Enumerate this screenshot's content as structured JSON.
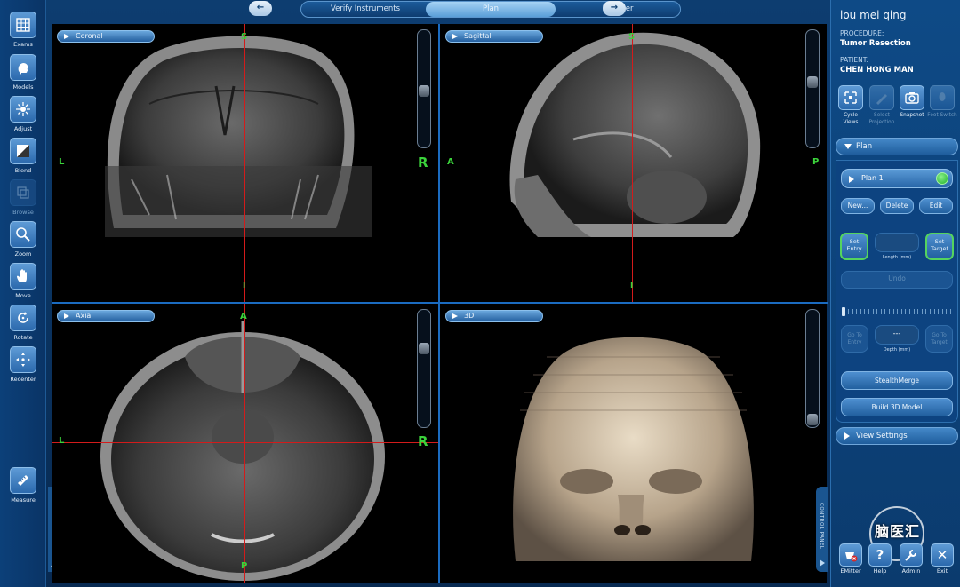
{
  "left_toolbar": {
    "tools": [
      {
        "label": "Exams",
        "icon": "grid-icon",
        "enabled": true
      },
      {
        "label": "Models",
        "icon": "head-model-icon",
        "enabled": true
      },
      {
        "label": "Adjust",
        "icon": "brightness-icon",
        "enabled": true
      },
      {
        "label": "Blend",
        "icon": "blend-icon",
        "enabled": true
      },
      {
        "label": "Browse",
        "icon": "browse-icon",
        "enabled": false
      },
      {
        "label": "Zoom",
        "icon": "zoom-icon",
        "enabled": true
      },
      {
        "label": "Move",
        "icon": "hand-icon",
        "enabled": true
      },
      {
        "label": "Rotate",
        "icon": "rotate-icon",
        "enabled": true
      },
      {
        "label": "Recenter",
        "icon": "recenter-icon",
        "enabled": true
      }
    ],
    "measure_label": "Measure",
    "modify_tab_label": "MODIFY IMAGES"
  },
  "workflow_tabs": {
    "items": [
      "Verify Instruments",
      "Plan",
      "Register"
    ],
    "active": "Plan"
  },
  "views": {
    "coronal": {
      "label": "Coronal",
      "top": "S",
      "bottom": "I",
      "left": "L",
      "right": "R"
    },
    "sagittal": {
      "label": "Sagittal",
      "top": "S",
      "bottom": "I",
      "left": "A",
      "right": "P"
    },
    "axial": {
      "label": "Axial",
      "top": "A",
      "bottom": "P",
      "left": "L",
      "right": "R"
    },
    "three_d": {
      "label": "3D"
    }
  },
  "right_panel": {
    "user": "lou mei qing",
    "procedure_key": "PROCEDURE:",
    "procedure_value": "Tumor Resection",
    "patient_key": "PATIENT:",
    "patient_value": "CHEN HONG MAN",
    "tools": [
      {
        "label": "Cycle Views",
        "icon": "cycle-views-icon",
        "enabled": true
      },
      {
        "label": "Select Projection",
        "icon": "projection-icon",
        "enabled": false
      },
      {
        "label": "Snapshot",
        "icon": "camera-icon",
        "enabled": true
      },
      {
        "label": "Foot Switch",
        "icon": "foot-switch-icon",
        "enabled": false
      }
    ],
    "plan_section": "Plan",
    "plan_name": "Plan 1",
    "new_label": "New...",
    "delete_label": "Delete",
    "edit_label": "Edit",
    "set_entry_label": "Set Entry",
    "set_target_label": "Set Target",
    "length_label": "Length (mm)",
    "undo_label": "Undo",
    "go_entry_label": "Go To Entry",
    "go_target_label": "Go To Target",
    "depth_value": "---",
    "depth_label": "Depth (mm)",
    "stealthmerge_label": "StealthMerge",
    "build3d_label": "Build 3D Model",
    "view_settings_label": "View Settings",
    "control_tab_label": "CONTROL PANEL"
  },
  "bottom_tools": [
    {
      "label": "EMitter",
      "icon": "emitter-icon"
    },
    {
      "label": "Help",
      "icon": "help-icon"
    },
    {
      "label": "Admin",
      "icon": "admin-icon"
    },
    {
      "label": "Exit",
      "icon": "close-icon"
    }
  ],
  "watermark_text": "脑医汇",
  "colors": {
    "crosshair": "#d31b1b",
    "orientation": "#3bd33b",
    "accent": "#1b6bc0"
  }
}
